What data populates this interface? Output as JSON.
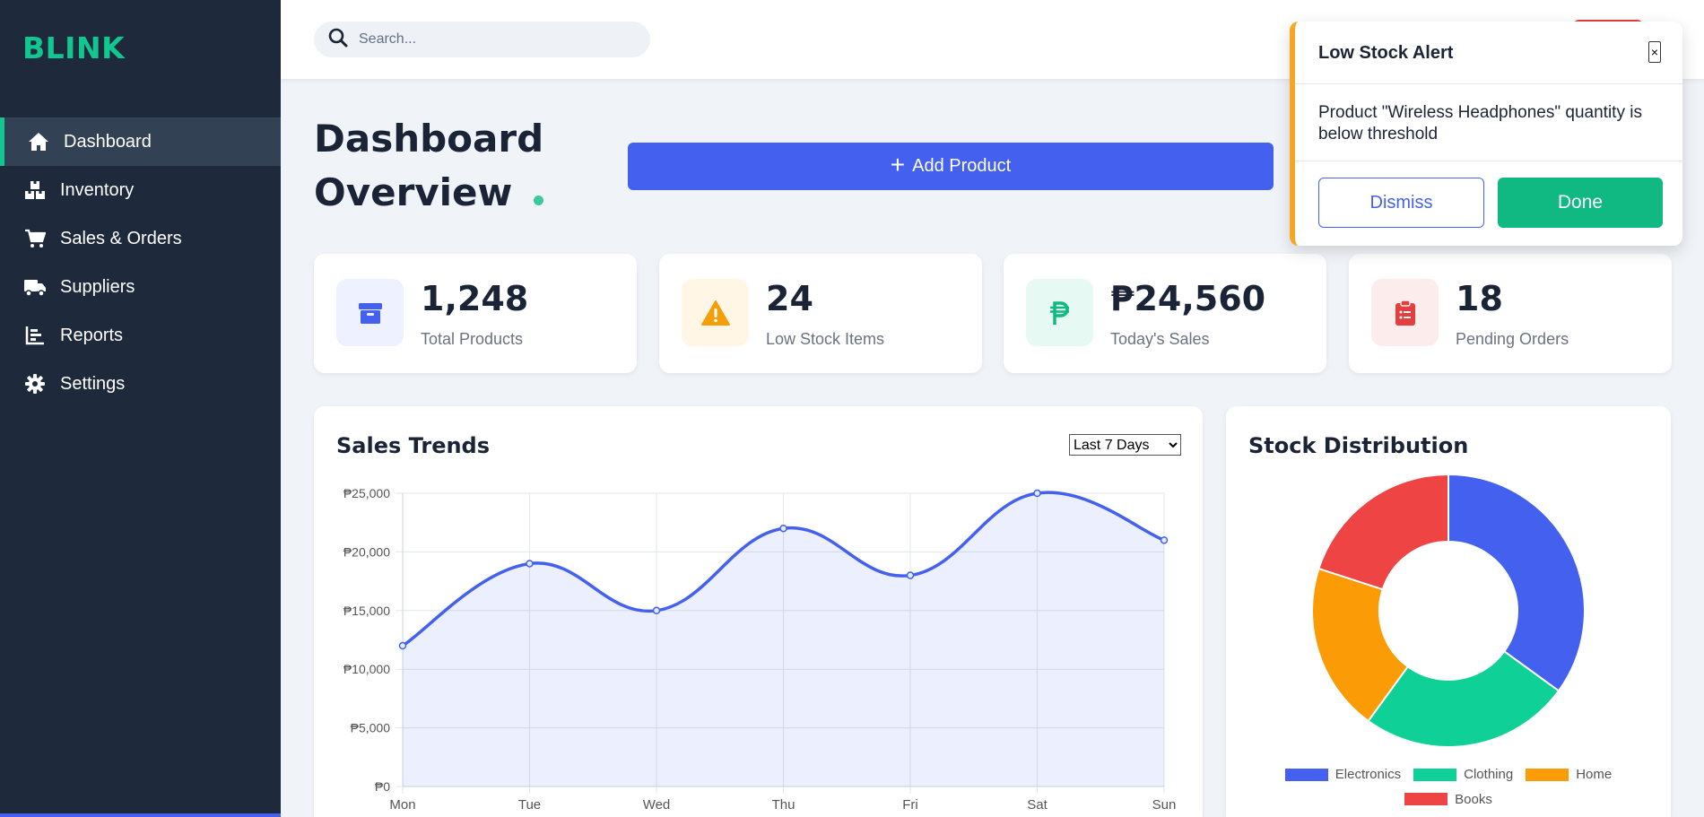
{
  "brand": "BLINK",
  "sidebar": {
    "items": [
      {
        "label": "Dashboard",
        "icon": "home-icon",
        "active": true
      },
      {
        "label": "Inventory",
        "icon": "boxes-icon"
      },
      {
        "label": "Sales & Orders",
        "icon": "cart-icon"
      },
      {
        "label": "Suppliers",
        "icon": "truck-icon"
      },
      {
        "label": "Reports",
        "icon": "bar-chart-icon"
      },
      {
        "label": "Settings",
        "icon": "gear-icon"
      }
    ]
  },
  "search": {
    "placeholder": "Search..."
  },
  "header": {
    "title_line1": "Dashboard",
    "title_line2": "Overview",
    "add_button": "Add Product"
  },
  "stats": [
    {
      "value": "1,248",
      "label": "Total Products",
      "icon": "box-icon",
      "color": "#4361ee",
      "bg": "#eef1ff"
    },
    {
      "value": "24",
      "label": "Low Stock Items",
      "icon": "warning-icon",
      "color": "#f59e0b",
      "bg": "#fff6e6"
    },
    {
      "value": "₱24,560",
      "label": "Today's Sales",
      "icon": "peso-icon",
      "color": "#10b981",
      "bg": "#e7f9f3"
    },
    {
      "value": "18",
      "label": "Pending Orders",
      "icon": "clipboard-icon",
      "color": "#e53e3e",
      "bg": "#fdecec"
    }
  ],
  "sales_panel": {
    "title": "Sales Trends",
    "range": "Last 7 Days"
  },
  "stock_panel": {
    "title": "Stock Distribution"
  },
  "chart_data": [
    {
      "type": "line",
      "title": "Sales Trends",
      "categories": [
        "Mon",
        "Tue",
        "Wed",
        "Thu",
        "Fri",
        "Sat",
        "Sun"
      ],
      "values": [
        12000,
        19000,
        15000,
        22000,
        18000,
        25000,
        21000
      ],
      "ylim": [
        0,
        25000
      ],
      "yticks": [
        "₱0",
        "₱5,000",
        "₱10,000",
        "₱15,000",
        "₱20,000",
        "₱25,000"
      ],
      "grid": true,
      "area_fill": true,
      "color": "#4361ee"
    },
    {
      "type": "pie",
      "title": "Stock Distribution",
      "donut": true,
      "labels": [
        "Electronics",
        "Clothing",
        "Home",
        "Books"
      ],
      "values": [
        35,
        25,
        20,
        20
      ],
      "colors": [
        "#4361ee",
        "#0fd197",
        "#fb9b05",
        "#ef4444"
      ],
      "legend": "bottom"
    }
  ],
  "alert": {
    "title": "Low Stock Alert",
    "close": "×",
    "message": "Product \"Wireless Headphones\" quantity is below threshold",
    "dismiss": "Dismiss",
    "done": "Done",
    "accent": "#f5a623"
  }
}
